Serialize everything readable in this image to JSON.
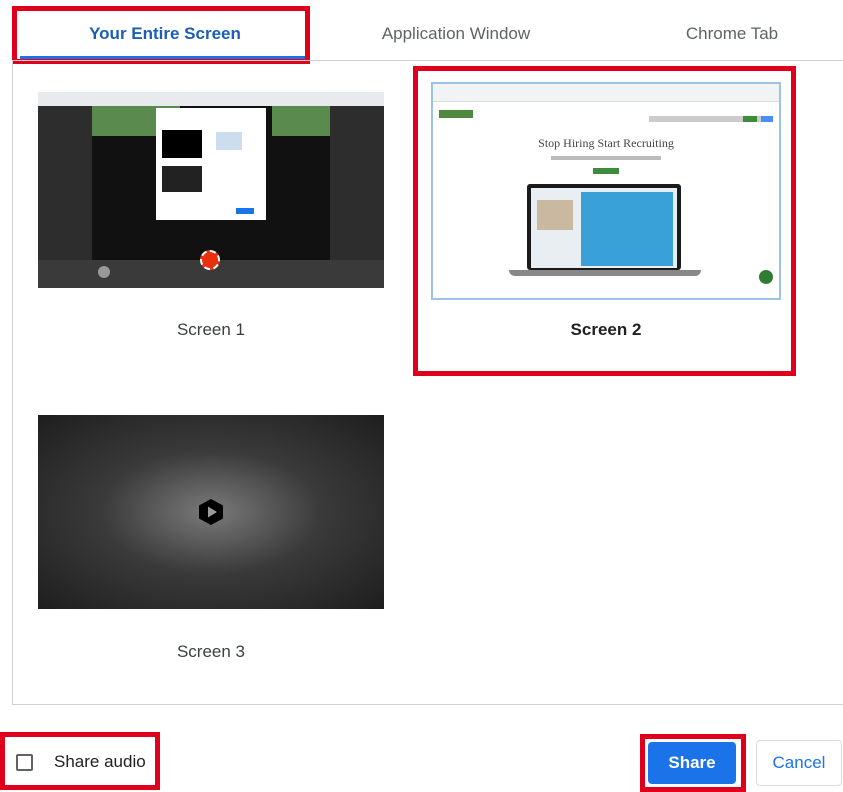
{
  "tabs": [
    {
      "label": "Your Entire Screen",
      "active": true
    },
    {
      "label": "Application Window",
      "active": false
    },
    {
      "label": "Chrome Tab",
      "active": false
    }
  ],
  "screens": [
    {
      "label": "Screen 1",
      "selected": false
    },
    {
      "label": "Screen 2",
      "selected": true
    },
    {
      "label": "Screen 3",
      "selected": false
    }
  ],
  "screen2_preview": {
    "headline": "Stop Hiring Start Recruiting"
  },
  "footer": {
    "share_audio_label": "Share audio",
    "share_audio_checked": false,
    "share_label": "Share",
    "cancel_label": "Cancel"
  },
  "colors": {
    "accent": "#1a73e8",
    "highlight": "#e0001b",
    "active_tab_text": "#1a5fb4"
  }
}
